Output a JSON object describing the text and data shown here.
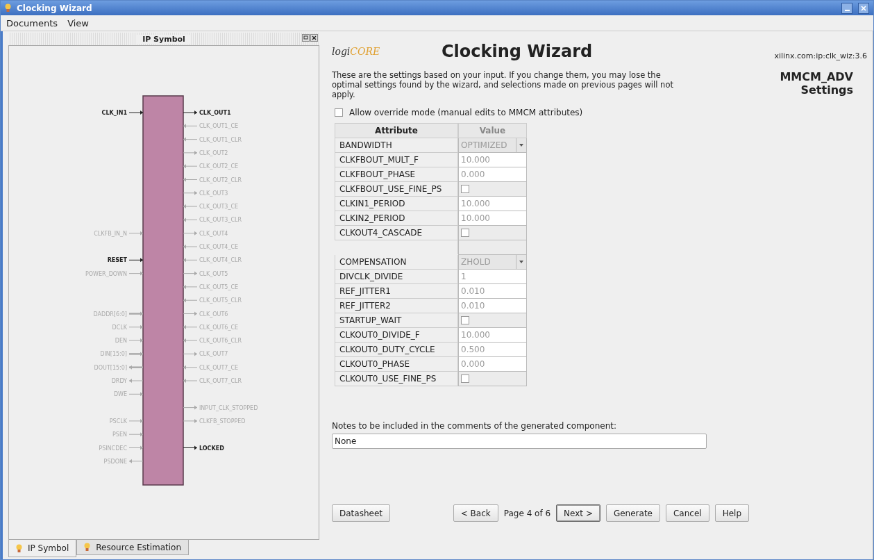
{
  "window": {
    "title": "Clocking Wizard"
  },
  "menu": [
    {
      "label": "Documents"
    },
    {
      "label": "View"
    }
  ],
  "left_panel": {
    "title": "IP Symbol",
    "symbol": {
      "left_pins": [
        {
          "name": "CLK_IN1",
          "active": true,
          "kind": "input"
        },
        {
          "name": "CLKFB_IN_N",
          "active": false,
          "kind": "input"
        },
        {
          "name": "RESET",
          "active": true,
          "kind": "input"
        },
        {
          "name": "POWER_DOWN",
          "active": false,
          "kind": "input"
        },
        {
          "name": "DADDR[6:0]",
          "active": false,
          "kind": "businput"
        },
        {
          "name": "DCLK",
          "active": false,
          "kind": "input"
        },
        {
          "name": "DEN",
          "active": false,
          "kind": "input"
        },
        {
          "name": "DIN[15:0]",
          "active": false,
          "kind": "businput"
        },
        {
          "name": "DOUT[15:0]",
          "active": false,
          "kind": "busoutput"
        },
        {
          "name": "DRDY",
          "active": false,
          "kind": "output"
        },
        {
          "name": "DWE",
          "active": false,
          "kind": "input"
        },
        {
          "name": "PSCLK",
          "active": false,
          "kind": "input"
        },
        {
          "name": "PSEN",
          "active": false,
          "kind": "input"
        },
        {
          "name": "PSINCDEC",
          "active": false,
          "kind": "input"
        },
        {
          "name": "PSDONE",
          "active": false,
          "kind": "output"
        }
      ],
      "right_pins": [
        {
          "name": "CLK_OUT1",
          "active": true,
          "kind": "output"
        },
        {
          "name": "CLK_OUT1_CE",
          "active": false,
          "kind": "input"
        },
        {
          "name": "CLK_OUT1_CLR",
          "active": false,
          "kind": "input"
        },
        {
          "name": "CLK_OUT2",
          "active": false,
          "kind": "output"
        },
        {
          "name": "CLK_OUT2_CE",
          "active": false,
          "kind": "input"
        },
        {
          "name": "CLK_OUT2_CLR",
          "active": false,
          "kind": "input"
        },
        {
          "name": "CLK_OUT3",
          "active": false,
          "kind": "output"
        },
        {
          "name": "CLK_OUT3_CE",
          "active": false,
          "kind": "input"
        },
        {
          "name": "CLK_OUT3_CLR",
          "active": false,
          "kind": "input"
        },
        {
          "name": "CLK_OUT4",
          "active": false,
          "kind": "output"
        },
        {
          "name": "CLK_OUT4_CE",
          "active": false,
          "kind": "input"
        },
        {
          "name": "CLK_OUT4_CLR",
          "active": false,
          "kind": "input"
        },
        {
          "name": "CLK_OUT5",
          "active": false,
          "kind": "output"
        },
        {
          "name": "CLK_OUT5_CE",
          "active": false,
          "kind": "input"
        },
        {
          "name": "CLK_OUT5_CLR",
          "active": false,
          "kind": "input"
        },
        {
          "name": "CLK_OUT6",
          "active": false,
          "kind": "output"
        },
        {
          "name": "CLK_OUT6_CE",
          "active": false,
          "kind": "input"
        },
        {
          "name": "CLK_OUT6_CLR",
          "active": false,
          "kind": "input"
        },
        {
          "name": "CLK_OUT7",
          "active": false,
          "kind": "output"
        },
        {
          "name": "CLK_OUT7_CE",
          "active": false,
          "kind": "input"
        },
        {
          "name": "CLK_OUT7_CLR",
          "active": false,
          "kind": "input"
        },
        {
          "name": "INPUT_CLK_STOPPED",
          "active": false,
          "kind": "output"
        },
        {
          "name": "CLKFB_STOPPED",
          "active": false,
          "kind": "output"
        },
        {
          "name": "LOCKED",
          "active": true,
          "kind": "output"
        }
      ]
    },
    "tabs": [
      {
        "label": "IP Symbol",
        "selected": true
      },
      {
        "label": "Resource Estimation",
        "selected": false
      }
    ]
  },
  "wizard": {
    "logo": {
      "prefix": "logi",
      "suffix": "CORE"
    },
    "title": "Clocking Wizard",
    "ip_version": "xilinx.com:ip:clk_wiz:3.6",
    "page_heading": [
      "MMCM_ADV",
      "Settings"
    ],
    "description": "These are the settings based on your input.  If you change them, you may lose the optimal settings found by the wizard, and selections made on previous pages will not apply.",
    "override": {
      "label": "Allow override mode (manual edits to MMCM attributes)",
      "checked": false
    },
    "table": {
      "columns": [
        "Attribute",
        "Value"
      ],
      "groups": [
        [
          {
            "attribute": "BANDWIDTH",
            "kind": "dropdown",
            "value": "OPTIMIZED",
            "disabled": true
          },
          {
            "attribute": "CLKFBOUT_MULT_F",
            "kind": "text",
            "value": "10.000",
            "disabled": true
          },
          {
            "attribute": "CLKFBOUT_PHASE",
            "kind": "text",
            "value": "0.000",
            "disabled": true
          },
          {
            "attribute": "CLKFBOUT_USE_FINE_PS",
            "kind": "checkbox",
            "checked": false
          },
          {
            "attribute": "CLKIN1_PERIOD",
            "kind": "text",
            "value": "10.000",
            "disabled": true
          },
          {
            "attribute": "CLKIN2_PERIOD",
            "kind": "text",
            "value": "10.000",
            "disabled": true
          },
          {
            "attribute": "CLKOUT4_CASCADE",
            "kind": "checkbox",
            "checked": false
          }
        ],
        [
          {
            "attribute": "COMPENSATION",
            "kind": "dropdown",
            "value": "ZHOLD",
            "disabled": true
          },
          {
            "attribute": "DIVCLK_DIVIDE",
            "kind": "text",
            "value": "1",
            "disabled": true
          },
          {
            "attribute": "REF_JITTER1",
            "kind": "text",
            "value": "0.010",
            "disabled": true
          },
          {
            "attribute": "REF_JITTER2",
            "kind": "text",
            "value": "0.010",
            "disabled": true
          },
          {
            "attribute": "STARTUP_WAIT",
            "kind": "checkbox",
            "checked": false
          },
          {
            "attribute": "CLKOUT0_DIVIDE_F",
            "kind": "text",
            "value": "10.000",
            "disabled": true
          },
          {
            "attribute": "CLKOUT0_DUTY_CYCLE",
            "kind": "text",
            "value": "0.500",
            "disabled": true
          },
          {
            "attribute": "CLKOUT0_PHASE",
            "kind": "text",
            "value": "0.000",
            "disabled": true
          },
          {
            "attribute": "CLKOUT0_USE_FINE_PS",
            "kind": "checkbox",
            "checked": false
          }
        ]
      ]
    },
    "notes": {
      "label": "Notes to be included in the comments of the generated component:",
      "value": "None"
    },
    "footer": {
      "datasheet": "Datasheet",
      "back": "< Back",
      "page": "Page 4 of 6",
      "next": "Next >",
      "generate": "Generate",
      "cancel": "Cancel",
      "help": "Help"
    }
  }
}
